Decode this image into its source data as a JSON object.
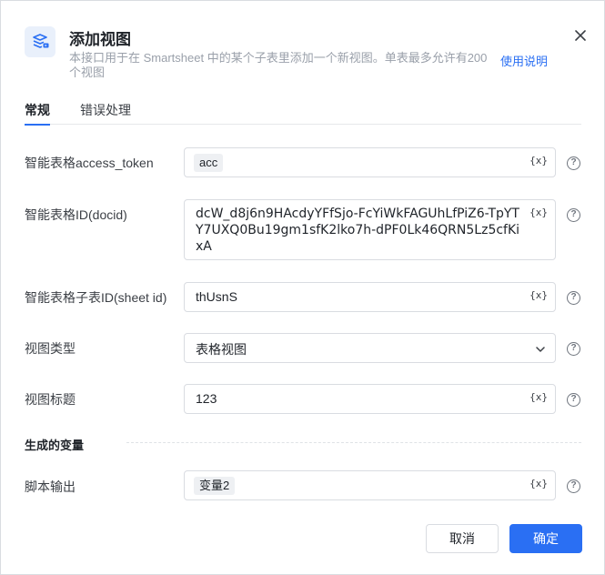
{
  "dialog": {
    "title": "添加视图",
    "description": "本接口用于在 Smartsheet 中的某个子表里添加一个新视图。单表最多允许有200个视图",
    "help_link": "使用说明",
    "close_icon": "close-icon",
    "header_icon": "smartsheet-view-icon"
  },
  "tabs": [
    {
      "label": "常规",
      "active": true
    },
    {
      "label": "错误处理",
      "active": false
    }
  ],
  "fields": {
    "access_token": {
      "label": "智能表格access_token",
      "value": "acc"
    },
    "docid": {
      "label": "智能表格ID(docid)",
      "value": "dcW_d8j6n9HAcdyYFfSjo-FcYiWkFAGUhLfPiZ6-TpYTY7UXQ0Bu19gm1sfK2lko7h-dPF0Lk46QRN5Lz5cfKixA"
    },
    "sheet_id": {
      "label": "智能表格子表ID(sheet id)",
      "value": "thUsnS"
    },
    "view_type": {
      "label": "视图类型",
      "value": "表格视图"
    },
    "view_title": {
      "label": "视图标题",
      "value": "123"
    }
  },
  "var_button": "{x}",
  "help_icon_glyph": "?",
  "output_section": {
    "title": "生成的变量",
    "script_output": {
      "label": "脚本输出",
      "value": "变量2"
    }
  },
  "buttons": {
    "cancel": "取消",
    "confirm": "确定"
  },
  "colors": {
    "accent": "#2a6ff3",
    "border": "#d9dce1",
    "muted_text": "#9aa0aa"
  }
}
